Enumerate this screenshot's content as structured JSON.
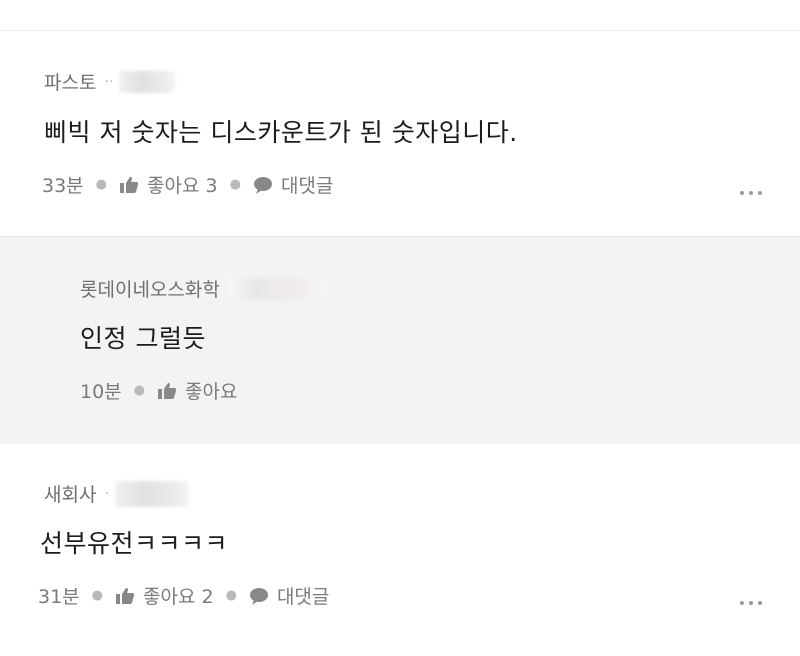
{
  "comments": [
    {
      "author": "파스토",
      "author_suffix": "··",
      "body": "삐빅 저 숫자는 디스카운트가 된 숫자입니다.",
      "time": "33분",
      "like_label": "좋아요 3",
      "reply_label": "대댓글"
    },
    {
      "author": "롯데이네오스화학",
      "body": "인정 그럴듯",
      "time": "10분",
      "like_label": "좋아요"
    },
    {
      "author": "새회사",
      "author_suffix": "·",
      "body": "선부유전ㅋㅋㅋㅋ",
      "time": "31분",
      "like_label": "좋아요 2",
      "reply_label": "대댓글"
    }
  ],
  "icons": {
    "like": "thumbs-up-icon",
    "reply": "speech-bubble-icon",
    "more": "more-dots-icon"
  },
  "colors": {
    "reply_background": "#f3f3f3",
    "meta_text": "#7a7a7a",
    "author_text": "#6f6f6f"
  }
}
